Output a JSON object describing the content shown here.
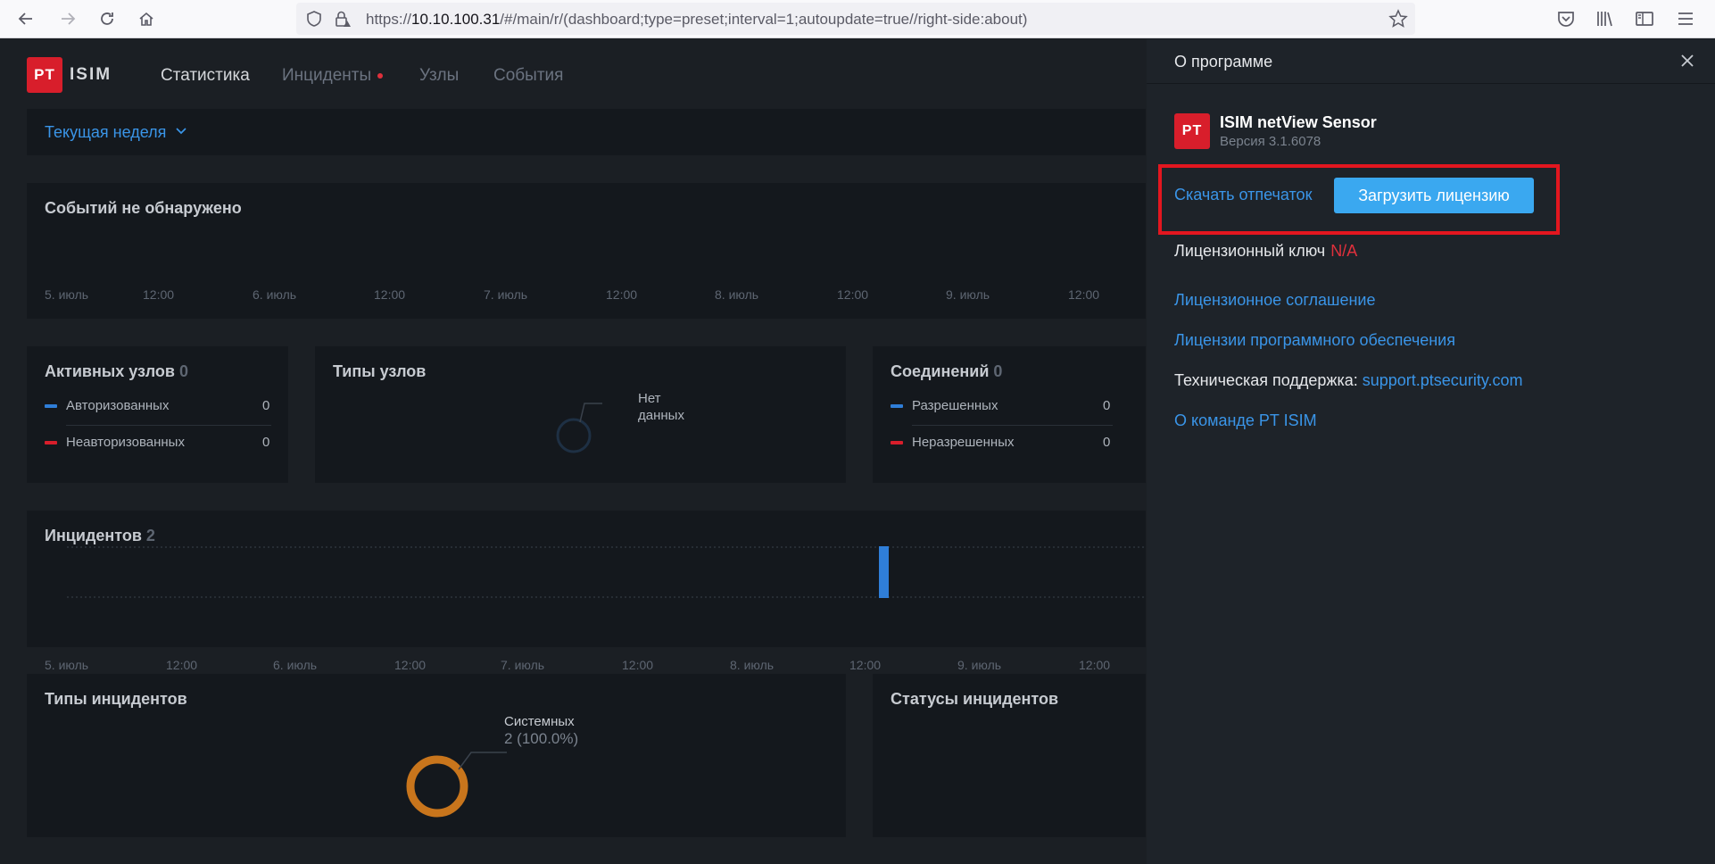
{
  "browser": {
    "url_prefix": "https://",
    "url_host": "10.10.100.31",
    "url_path": "/#/main/r/(dashboard;type=preset;interval=1;autoupdate=true//right-side:about)"
  },
  "app": {
    "logo_mark": "PT",
    "logo_text": "ISIM",
    "nav": {
      "statistics": "Статистика",
      "incidents": "Инциденты",
      "nodes": "Узлы",
      "events": "События"
    },
    "period": "Текущая неделя"
  },
  "events_panel": {
    "title": "Событий не обнаружено",
    "ticks": [
      "5. июль",
      "12:00",
      "6. июль",
      "12:00",
      "7. июль",
      "12:00",
      "8. июль",
      "12:00",
      "9. июль",
      "12:00"
    ]
  },
  "active_nodes": {
    "title": "Активных узлов",
    "count": "0",
    "rows": [
      {
        "label": "Авторизованных",
        "value": "0",
        "color": "#2f7ed8"
      },
      {
        "label": "Неавторизованных",
        "value": "0",
        "color": "#d81e2b"
      }
    ]
  },
  "node_types": {
    "title": "Типы узлов",
    "no_data_1": "Нет",
    "no_data_2": "данных"
  },
  "connections": {
    "title": "Соединений",
    "count": "0",
    "rows": [
      {
        "label": "Разрешенных",
        "value": "0",
        "color": "#2f7ed8"
      },
      {
        "label": "Неразрешенных",
        "value": "0",
        "color": "#d81e2b"
      }
    ]
  },
  "incidents_panel": {
    "title": "Инцидентов",
    "count": "2",
    "ticks": [
      "5. июль",
      "12:00",
      "6. июль",
      "12:00",
      "7. июль",
      "12:00",
      "8. июль",
      "12:00",
      "9. июль",
      "12:00"
    ],
    "bar_color": "#2f7ed8"
  },
  "incident_types": {
    "title": "Типы инцидентов",
    "slice_label": "Системных",
    "slice_value": "2 (100.0%)",
    "ring_color": "#c8751c"
  },
  "incident_statuses": {
    "title": "Статусы инцидентов"
  },
  "about": {
    "title": "О программе",
    "product_mark": "PT",
    "product_name": "ISIM netView Sensor",
    "version": "Версия 3.1.6078",
    "download_fingerprint": "Скачать отпечаток",
    "upload_license": "Загрузить лицензию",
    "license_key_label": "Лицензионный ключ",
    "license_key_value": "N/A",
    "license_agreement": "Лицензионное соглашение",
    "software_licenses": "Лицензии программного обеспечения",
    "support_label": "Техническая поддержка:",
    "support_link": "support.ptsecurity.com",
    "team": "О команде PT ISIM"
  }
}
